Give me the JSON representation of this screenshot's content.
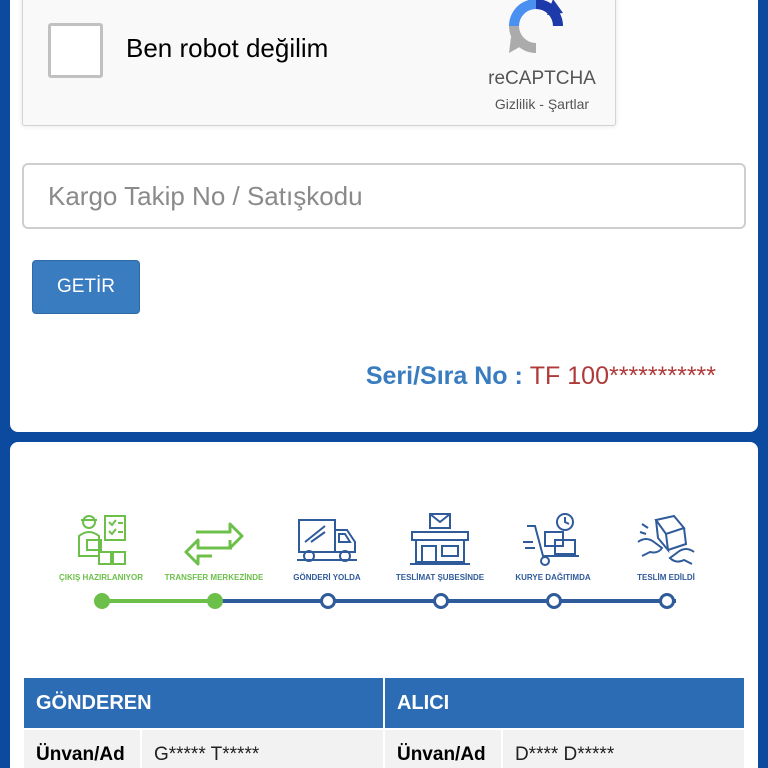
{
  "captcha": {
    "label": "Ben robot değilim",
    "brand": "reCAPTCHA",
    "privacy": "Gizlilik",
    "separator": " - ",
    "terms": "Şartlar"
  },
  "search": {
    "placeholder": "Kargo Takip No / Satışkodu",
    "value": ""
  },
  "submit_label": "GETİR",
  "serial": {
    "label": "Seri/Sıra No : ",
    "value": "TF 100***********"
  },
  "colors": {
    "page_background": "#0b4a9e",
    "step_done": "#6cc04a",
    "step_pending": "#2f5b9b",
    "table_header": "#2b6cb4",
    "serial_label": "#3a7cc0",
    "serial_value": "#b03a3a"
  },
  "steps": [
    {
      "label": "ÇIKIŞ HAZIRLANIYOR",
      "icon": "packing-worker-icon",
      "status": "done"
    },
    {
      "label": "TRANSFER MERKEZİNDE",
      "icon": "transfer-arrows-icon",
      "status": "done"
    },
    {
      "label": "GÖNDERİ YOLDA",
      "icon": "delivery-truck-icon",
      "status": "pending"
    },
    {
      "label": "TESLİMAT ŞUBESİNDE",
      "icon": "branch-store-icon",
      "status": "pending"
    },
    {
      "label": "KURYE DAĞITIMDA",
      "icon": "hand-truck-clock-icon",
      "status": "pending"
    },
    {
      "label": "TESLİM EDİLDİ",
      "icon": "handover-package-icon",
      "status": "pending"
    }
  ],
  "table": {
    "sender_header": "GÖNDEREN",
    "receiver_header": "ALICI",
    "rows": [
      {
        "label": "Ünvan/Ad",
        "sender": "G***** T*****",
        "receiver_label": "Ünvan/Ad",
        "receiver": "D**** D*****"
      }
    ]
  }
}
